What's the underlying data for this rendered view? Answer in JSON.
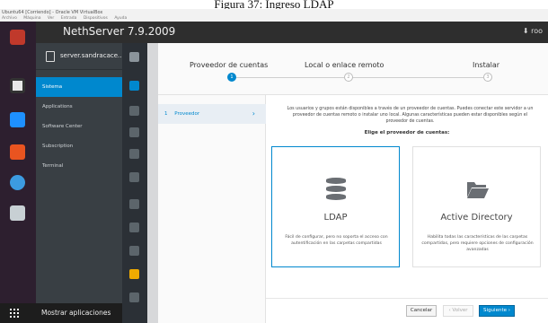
{
  "caption": "Figura 37: Ingreso LDAP",
  "vm_window": {
    "title": "Ubuntu64 [Corriendo] - Oracle VM VirtualBox",
    "menu": [
      "Archivo",
      "Máquina",
      "Ver",
      "Entrada",
      "Dispositivos",
      "Ayuda"
    ]
  },
  "topbar": {
    "host": "NethServer 7.9.2009",
    "user_glyph": "⬇ roo"
  },
  "sidebar": {
    "server": "server.sandracace...",
    "items": [
      {
        "label": "Sistema",
        "active": true
      },
      {
        "label": "Applications",
        "active": false
      },
      {
        "label": "Software Center",
        "active": false
      },
      {
        "label": "Subscription",
        "active": false
      },
      {
        "label": "Terminal",
        "active": false
      }
    ]
  },
  "show_apps_label": "Mostrar aplicaciones",
  "wizard": {
    "steps": [
      {
        "label": "Proveedor de cuentas",
        "num": "1",
        "active": true
      },
      {
        "label": "Local o enlace remoto",
        "num": "2",
        "active": false
      },
      {
        "label": "Instalar",
        "num": "3",
        "active": false
      }
    ],
    "substep": {
      "num": "1",
      "label": "Proveedor",
      "chevron": "›"
    },
    "intro": "Los usuarios y grupos están disponibles a través de un proveedor de cuentas. Puedes conectar este servidor a un proveedor de cuentas remoto o instalar uno local. Algunas características pueden estar disponibles según el proveedor de cuentas.",
    "choose_label": "Elige el proveedor de cuentas:",
    "options": [
      {
        "title": "LDAP",
        "icon": "database-icon",
        "desc": "Fácil de configurar, pero no soporta el acceso con autentificación en las carpetas compartidas",
        "selected": true
      },
      {
        "title": "Active Directory",
        "icon": "folder-open-icon",
        "desc": "Habilita todas las características de las carpetas compartidas, pero requiere opciones de configuración avanzadas",
        "selected": false
      }
    ],
    "buttons": {
      "cancel": "Cancelar",
      "back": "‹ Volver",
      "next": "Siguiente ›"
    }
  },
  "colors": {
    "accent": "#0088ce",
    "sidebar": "#393f44"
  }
}
